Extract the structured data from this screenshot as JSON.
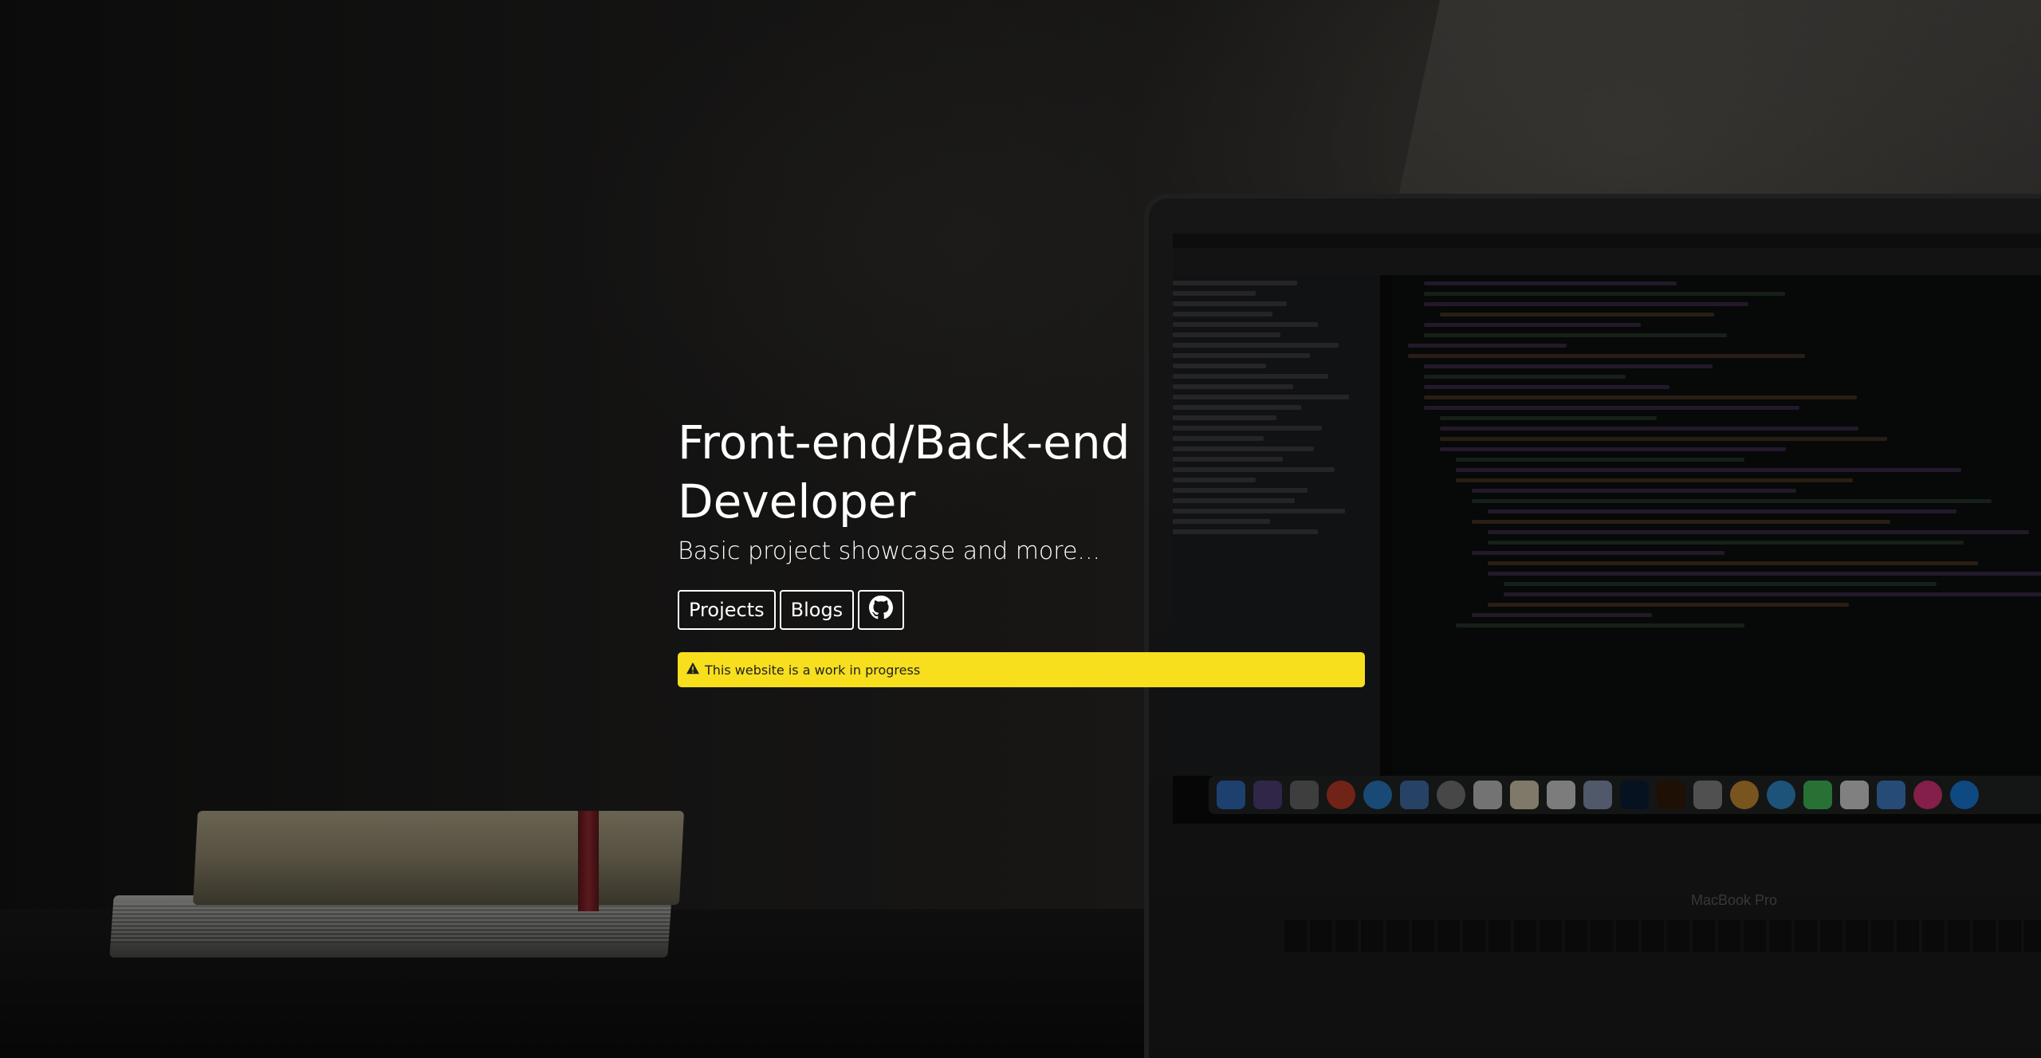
{
  "hero": {
    "title": "Front-end/Back-end Developer",
    "subtitle": "Basic project showcase and more..."
  },
  "buttons": {
    "projects_label": "Projects",
    "blogs_label": "Blogs",
    "github_icon": "github-icon"
  },
  "alert": {
    "icon": "warning-icon",
    "text": "This website is a work in progress",
    "color": "#f7df1e"
  },
  "background": {
    "laptop_brand": "MacBook Pro"
  }
}
